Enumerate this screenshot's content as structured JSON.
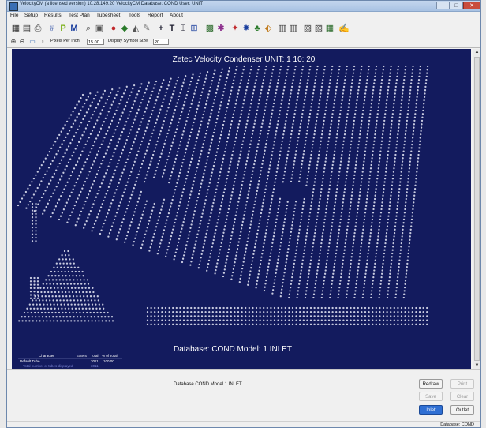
{
  "window": {
    "title": "VelocityCM (a licensed version) 10.28.149.20 VelocityCM   Database: COND  User: UNIT",
    "min_label": "–",
    "max_label": "□",
    "close_label": "✕"
  },
  "menu": [
    "File",
    "Setup",
    "Results",
    "Test Plan",
    "Tubesheet",
    "Tools",
    "Report",
    "About"
  ],
  "toolbar2": {
    "pixels_label": "Pixels Per Inch",
    "pixels_value": "15.00",
    "symbol_label": "Display Symbol Size",
    "symbol_value": "20"
  },
  "plot": {
    "title": "Zetec Velocity Condenser UNIT: 1 10: 20",
    "footer": "Database: COND  Model: 1  INLET",
    "colors": {
      "background": "#131b5e",
      "tube": "#c8cbe0"
    },
    "legend": {
      "headers": [
        "Character",
        "Extent",
        "Total",
        "% of Total"
      ],
      "rows": [
        {
          "name": "Default Tube",
          "extent": "",
          "total": "3011",
          "pct": "100.00"
        },
        {
          "name": "Total number of tubes displayed",
          "extent": "",
          "total": "3011",
          "pct": ""
        }
      ]
    }
  },
  "bottom": {
    "info": "Database COND  Model 1  INLET",
    "buttons": {
      "redraw": "Redraw",
      "print": "Print",
      "save": "Save",
      "clear": "Clear",
      "inlet": "Inlet",
      "outlet": "Outlet"
    }
  },
  "status": "Database: COND"
}
